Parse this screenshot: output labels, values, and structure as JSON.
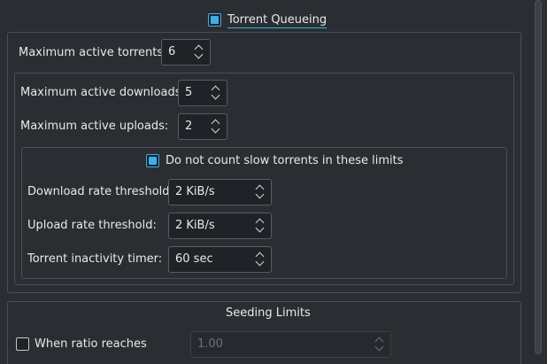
{
  "queueing": {
    "title": "Torrent Queueing",
    "checked": true,
    "max_active_torrents_label": "Maximum active torrents:",
    "max_active_torrents_value": "6",
    "max_active_downloads_label": "Maximum active downloads:",
    "max_active_downloads_value": "5",
    "max_active_uploads_label": "Maximum active uploads:",
    "max_active_uploads_value": "2",
    "slow": {
      "title": "Do not count slow torrents in these limits",
      "checked": true,
      "download_threshold_label": "Download rate threshold:",
      "download_threshold_value": "2 KiB/s",
      "upload_threshold_label": "Upload rate threshold:",
      "upload_threshold_value": "2 KiB/s",
      "inactivity_timer_label": "Torrent inactivity timer:",
      "inactivity_timer_value": "60 sec"
    }
  },
  "seeding": {
    "title": "Seeding Limits",
    "ratio_label": "When ratio reaches",
    "ratio_checked": false,
    "ratio_value": "1.00"
  },
  "colors": {
    "background": "#2a2e32",
    "accent": "#3daee9",
    "border": "#4a4f55"
  }
}
